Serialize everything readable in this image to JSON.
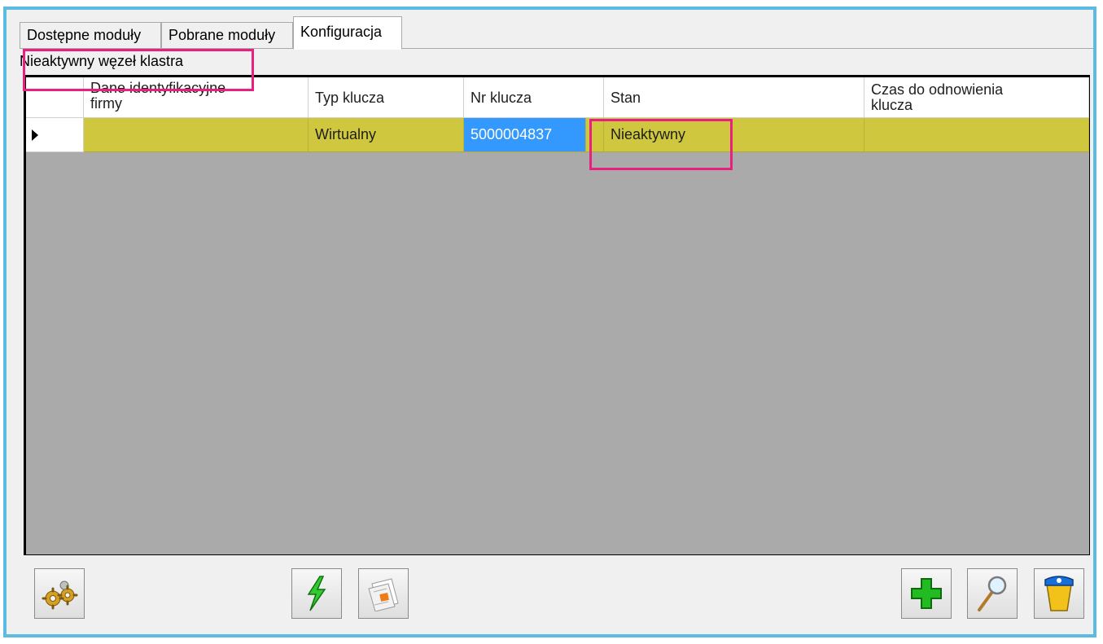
{
  "tabs": [
    {
      "label": "Dostępne moduły",
      "active": false
    },
    {
      "label": "Pobrane moduły",
      "active": false
    },
    {
      "label": "Konfiguracja",
      "active": true
    }
  ],
  "section_label": "Nieaktywny węzeł klastra",
  "grid": {
    "columns": [
      {
        "line1": "Dane identyfikacyjne",
        "line2": "firmy"
      },
      {
        "line1": "Typ klucza",
        "line2": ""
      },
      {
        "line1": "Nr klucza",
        "line2": ""
      },
      {
        "line1": "Stan",
        "line2": ""
      },
      {
        "line1": "Czas do odnowienia",
        "line2": "klucza"
      }
    ],
    "rows": [
      {
        "firm": "",
        "key_type": "Wirtualny",
        "key_number": "5000004837",
        "state": "Nieaktywny",
        "renewal": ""
      }
    ]
  },
  "toolbar": {
    "left": [
      "gears-icon"
    ],
    "center": [
      "lightning-icon",
      "documents-icon"
    ],
    "right": [
      "plus-icon",
      "magnifier-icon",
      "recycle-bin-icon"
    ]
  },
  "colors": {
    "row_highlight": "#cfc83e",
    "selection": "#3399ff",
    "annotation": "#e8217e",
    "window_border": "#5bbbe0",
    "grid_background": "#aaaaaa"
  }
}
